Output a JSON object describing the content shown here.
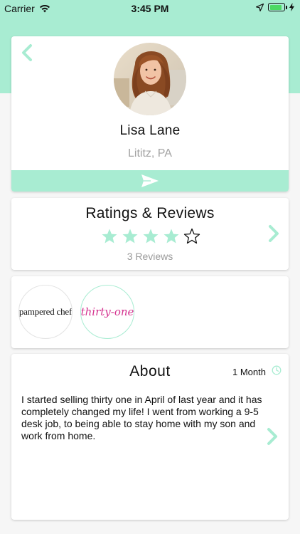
{
  "status_bar": {
    "carrier": "Carrier",
    "time": "3:45 PM",
    "battery_level": 0.85
  },
  "colors": {
    "accent": "#a8ecd2",
    "star_filled": "#a8ecd2",
    "thirty_one_pink": "#d4328f"
  },
  "profile": {
    "name": "Lisa Lane",
    "location": "Lititz, PA",
    "back_icon": "chevron-left-icon",
    "send_icon": "paper-plane-icon"
  },
  "ratings": {
    "title": "Ratings & Reviews",
    "stars_filled": 4,
    "stars_total": 5,
    "reviews_count_label": "3 Reviews"
  },
  "companies": [
    {
      "name": "pampered chef",
      "display": "pampered chef"
    },
    {
      "name": "thirty-one",
      "display": "thirty-one"
    }
  ],
  "about": {
    "title": "About",
    "duration": "1 Month",
    "body": "I started selling thirty one in April of last year and it has completely changed my life! I went from working a 9-5 desk job, to being able to stay home with my son and work from home."
  }
}
